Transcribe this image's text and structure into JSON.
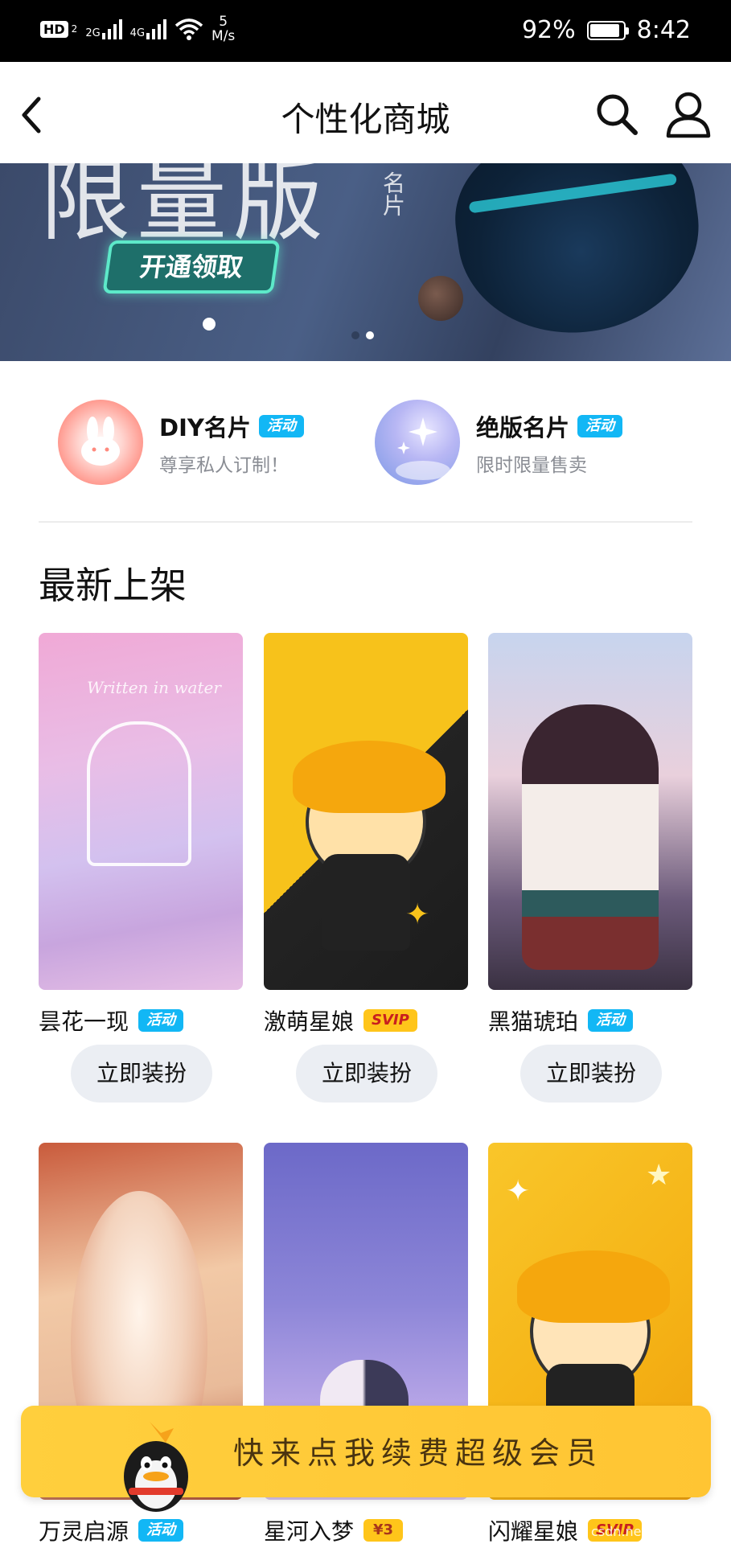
{
  "status_bar": {
    "hd": "HD",
    "hd_sub": "2",
    "net1": "2G",
    "net2": "4G",
    "speed_value": "5",
    "speed_unit": "M/s",
    "battery": "92%",
    "time": "8:42"
  },
  "nav": {
    "title": "个性化商城"
  },
  "banner": {
    "big_text": "限量版",
    "small_text": "名片",
    "button": "开通领取",
    "pages": 2,
    "active_page": 1
  },
  "features": [
    {
      "title": "DIY名片",
      "tag": "活动",
      "subtitle": "尊享私人订制！"
    },
    {
      "title": "绝版名片",
      "tag": "活动",
      "subtitle": "限时限量售卖"
    }
  ],
  "section": {
    "title": "最新上架"
  },
  "products": [
    {
      "name": "昙花一现",
      "tag": "活动",
      "button": "立即装扮",
      "art_text": "Written in water"
    },
    {
      "name": "激萌星娘",
      "tag": "SVIP",
      "button": "立即装扮"
    },
    {
      "name": "黑猫琥珀",
      "tag": "活动",
      "button": "立即装扮"
    },
    {
      "name": "万灵启源",
      "tag": "活动"
    },
    {
      "name": "星河入梦",
      "tag": "¥3"
    },
    {
      "name": "闪耀星娘",
      "tag": "SVIP"
    }
  ],
  "promo": {
    "text": "快来点我续费超级会员"
  },
  "watermark": "csdn.net/RONNIE_Zz",
  "colors": {
    "activity_tag": "#12b7f5",
    "svip_tag": "#ffc51a",
    "promo_bar": "#ffc533",
    "button_bg": "#ebeef3"
  }
}
